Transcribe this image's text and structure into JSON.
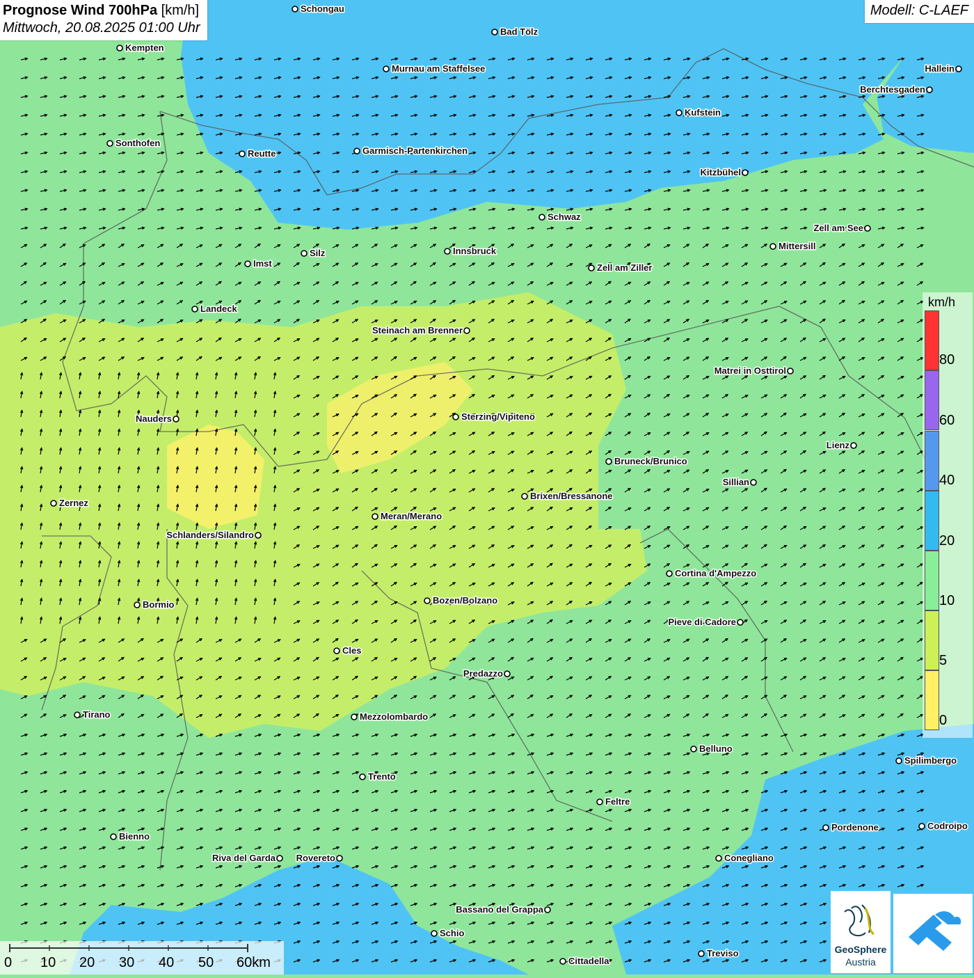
{
  "title": {
    "main": "Prognose Wind 700hPa",
    "unit": "[km/h]",
    "datetime": "Mittwoch, 20.08.2025 01:00 Uhr"
  },
  "model": "Modell: C-LAEF",
  "legend": {
    "unit": "km/h",
    "ticks": [
      "80",
      "60",
      "40",
      "20",
      "10",
      "5",
      "0"
    ],
    "colors": [
      "#ff3333",
      "#9966ee",
      "#5599ee",
      "#33bbf0",
      "#88ee99",
      "#ccf055",
      "#fff066"
    ]
  },
  "scalebar": {
    "labels": [
      "0",
      "10",
      "20",
      "30",
      "40",
      "50",
      "60km"
    ]
  },
  "logo": {
    "line1": "GeoSphere",
    "line2": "Austria"
  },
  "cities": [
    {
      "name": "Schongau",
      "anchor": "start"
    },
    {
      "name": "Bad Tölz",
      "anchor": "start"
    },
    {
      "name": "Kempten",
      "anchor": "start"
    },
    {
      "name": "Murnau am Staffelsee",
      "anchor": "start"
    },
    {
      "name": "Hallein",
      "anchor": "end"
    },
    {
      "name": "Berchtesgaden",
      "anchor": "end"
    },
    {
      "name": "Kufstein",
      "anchor": "start"
    },
    {
      "name": "Sonthofen",
      "anchor": "start"
    },
    {
      "name": "Reutte",
      "anchor": "start"
    },
    {
      "name": "Garmisch-Partenkirchen",
      "anchor": "start"
    },
    {
      "name": "Kitzbühel",
      "anchor": "end"
    },
    {
      "name": "Schwaz",
      "anchor": "start"
    },
    {
      "name": "Zell am See",
      "anchor": "end"
    },
    {
      "name": "Mittersill",
      "anchor": "start"
    },
    {
      "name": "Innsbruck",
      "anchor": "start"
    },
    {
      "name": "Silz",
      "anchor": "start"
    },
    {
      "name": "Imst",
      "anchor": "start"
    },
    {
      "name": "Zell am Ziller",
      "anchor": "start"
    },
    {
      "name": "Landeck",
      "anchor": "start"
    },
    {
      "name": "Steinach am Brenner",
      "anchor": "end"
    },
    {
      "name": "Matrei in Osttirol",
      "anchor": "end"
    },
    {
      "name": "Nauders",
      "anchor": "end"
    },
    {
      "name": "Sterzing/Vipiteno",
      "anchor": "start"
    },
    {
      "name": "Lienz",
      "anchor": "end"
    },
    {
      "name": "Bruneck/Brunico",
      "anchor": "start"
    },
    {
      "name": "Sillian",
      "anchor": "end"
    },
    {
      "name": "Zernez",
      "anchor": "start"
    },
    {
      "name": "Brixen/Bressanone",
      "anchor": "start"
    },
    {
      "name": "Meran/Merano",
      "anchor": "start"
    },
    {
      "name": "Schlanders/Silandro",
      "anchor": "end"
    },
    {
      "name": "Cortina d'Ampezzo",
      "anchor": "start"
    },
    {
      "name": "Bozen/Bolzano",
      "anchor": "start"
    },
    {
      "name": "Bormio",
      "anchor": "start"
    },
    {
      "name": "Pieve di Cadore",
      "anchor": "end"
    },
    {
      "name": "Cles",
      "anchor": "start"
    },
    {
      "name": "Predazzo",
      "anchor": "end"
    },
    {
      "name": "Tirano",
      "anchor": "start"
    },
    {
      "name": "Mezzolombardo",
      "anchor": "start"
    },
    {
      "name": "Belluno",
      "anchor": "start"
    },
    {
      "name": "Spilimbergo",
      "anchor": "start"
    },
    {
      "name": "Trento",
      "anchor": "start"
    },
    {
      "name": "Feltre",
      "anchor": "start"
    },
    {
      "name": "Pordenone",
      "anchor": "start"
    },
    {
      "name": "Codroipo",
      "anchor": "start"
    },
    {
      "name": "Bienno",
      "anchor": "start"
    },
    {
      "name": "Riva del Garda",
      "anchor": "end"
    },
    {
      "name": "Rovereto",
      "anchor": "end"
    },
    {
      "name": "Conegliano",
      "anchor": "start"
    },
    {
      "name": "Bassano del Grappa",
      "anchor": "end"
    },
    {
      "name": "Schio",
      "anchor": "start"
    },
    {
      "name": "Treviso",
      "anchor": "start"
    },
    {
      "name": "Cittadella",
      "anchor": "start"
    }
  ]
}
